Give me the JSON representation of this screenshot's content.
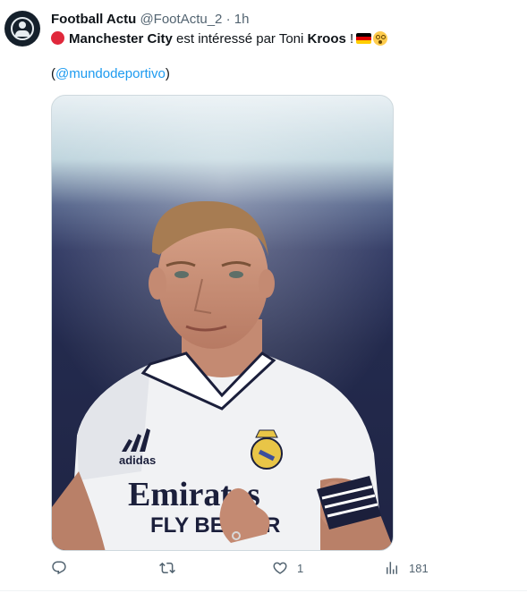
{
  "tweet": {
    "author_name": "Football Actu",
    "author_handle": "@FootActu_2",
    "separator": "·",
    "time": "1h",
    "text_part1": "Manchester City",
    "text_part2": " est intéressé par Toni ",
    "text_part3": "Kroos",
    "text_part4": " !",
    "mention_open": "(",
    "mention": "@mundodeportivo",
    "mention_close": ")",
    "image_text_sponsor": "Emirates",
    "image_text_sponsor_sub": "FLY BETTER",
    "image_text_brand": "adidas"
  },
  "actions": {
    "reply_count": "",
    "retweet_count": "",
    "like_count": "1",
    "views_count": "181"
  },
  "colors": {
    "accent": "#1d9bf0",
    "secondary_text": "#536471",
    "red_dot": "#e0283b"
  },
  "icons": [
    "avatar-default-icon",
    "red-circle-emoji-icon",
    "germany-flag-icon",
    "flushed-face-emoji-icon",
    "reply-icon",
    "retweet-icon",
    "like-icon",
    "views-icon"
  ]
}
